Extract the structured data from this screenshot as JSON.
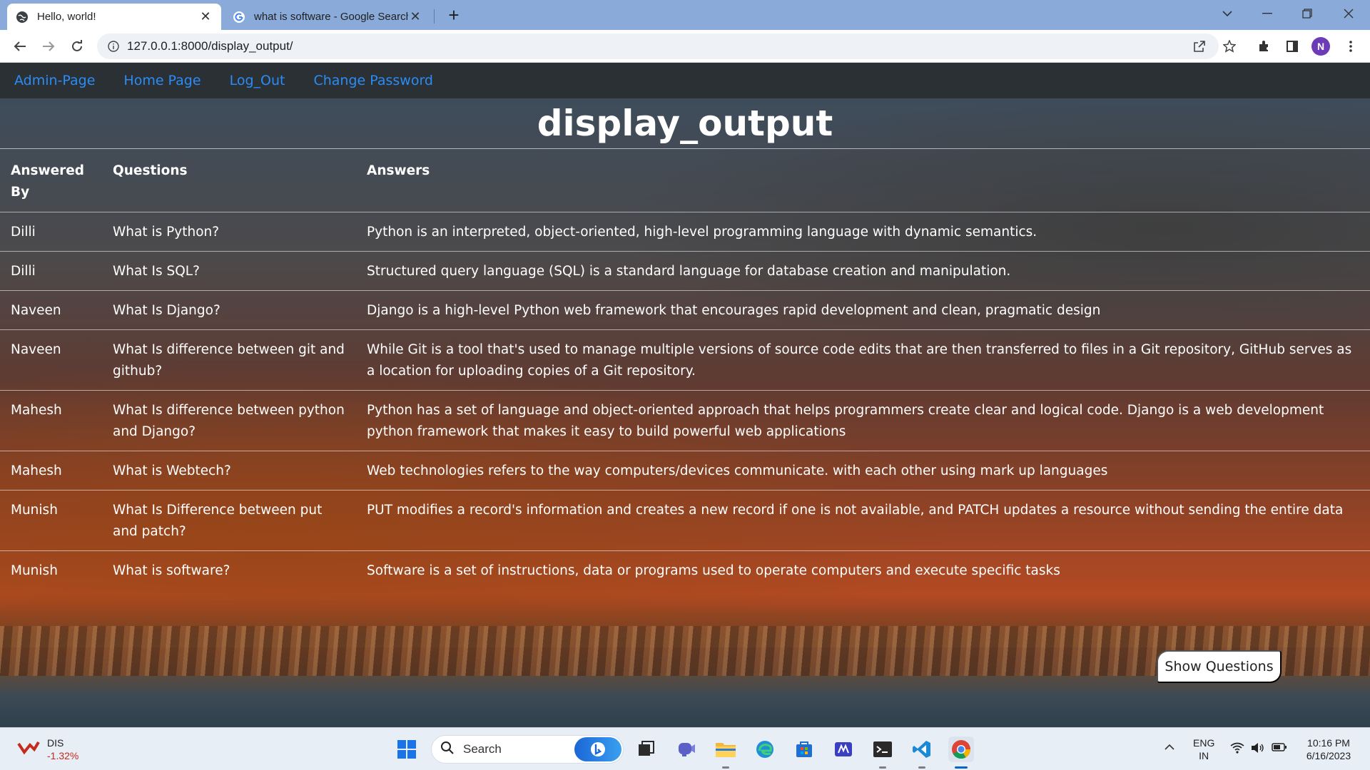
{
  "browser": {
    "tabs": [
      {
        "title": "Hello, world!",
        "active": true,
        "icon": "globe-icon"
      },
      {
        "title": "what is software - Google Search",
        "active": false,
        "icon": "google-icon"
      }
    ],
    "url": "127.0.0.1:8000/display_output/",
    "profile_initial": "N"
  },
  "nav": {
    "links": [
      "Admin-Page",
      "Home Page",
      "Log_Out",
      "Change Password"
    ],
    "link_color": "#2b8cf5"
  },
  "page": {
    "title": "display_output",
    "table": {
      "headers": [
        "Answered By",
        "Questions",
        "Answers"
      ],
      "rows": [
        {
          "by": "Dilli",
          "question": "What is Python?",
          "answer": "Python is an interpreted, object-oriented, high-level programming language with dynamic semantics."
        },
        {
          "by": "Dilli",
          "question": "What Is SQL?",
          "answer": "Structured query language (SQL) is a standard language for database creation and manipulation."
        },
        {
          "by": "Naveen",
          "question": "What Is Django?",
          "answer": "Django is a high-level Python web framework that encourages rapid development and clean, pragmatic design"
        },
        {
          "by": "Naveen",
          "question": "What Is difference between git and github?",
          "answer": "While Git is a tool that's used to manage multiple versions of source code edits that are then transferred to files in a Git repository, GitHub serves as a location for uploading copies of a Git repository."
        },
        {
          "by": "Mahesh",
          "question": "What Is difference between python and Django?",
          "answer": "Python has a set of language and object-oriented approach that helps programmers create clear and logical code. Django is a web development python framework that makes it easy to build powerful web applications"
        },
        {
          "by": "Mahesh",
          "question": "What is Webtech?",
          "answer": "Web technologies refers to the way computers/devices communicate. with each other using mark up languages"
        },
        {
          "by": "Munish",
          "question": "What Is Difference between put and patch?",
          "answer": "PUT modifies a record's information and creates a new record if one is not available, and PATCH updates a resource without sending the entire data"
        },
        {
          "by": "Munish",
          "question": "What is software?",
          "answer": "Software is a set of instructions, data or programs used to operate computers and execute specific tasks"
        }
      ]
    },
    "show_button": "Show Questions"
  },
  "taskbar": {
    "stock": {
      "ticker": "DIS",
      "change": "-1.32%",
      "change_color": "#c42b1c"
    },
    "search_label": "Search",
    "apps": [
      "windows-start-icon",
      "task-view-icon",
      "teams-icon",
      "file-explorer-icon",
      "edge-icon",
      "store-icon",
      "app-icon",
      "terminal-icon",
      "vscode-icon",
      "chrome-icon"
    ],
    "language": [
      "ENG",
      "IN"
    ],
    "time": "10:16 PM",
    "date": "6/16/2023"
  }
}
